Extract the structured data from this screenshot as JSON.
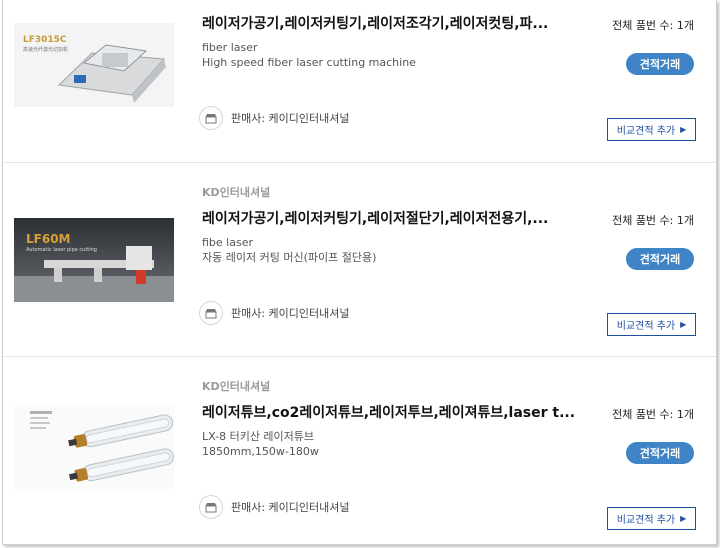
{
  "products": [
    {
      "brand": "",
      "title": "레이저가공기,레이저커팅기,레이저조각기,레이저컷팅,파...",
      "desc1": "fiber laser",
      "desc2": "High speed fiber laser cutting machine",
      "image_text": "LF3015C",
      "image_subtext": "高速光纤激光切割机",
      "seller": "판매사: 케이디인터내셔널",
      "count": "전체 품번 수: 1개",
      "quote": "견적거래",
      "compare": "비교견적 추가"
    },
    {
      "brand": "KD인터내셔널",
      "title": "레이저가공기,레이저커팅기,레이저절단기,레이저전용기,...",
      "desc1": "fibe laser",
      "desc2": "자동 레이저 커팅 머신(파이프 절단용)",
      "image_text": "LF60M",
      "image_subtext": "Automatic laser pipe cutting",
      "seller": "판매사: 케이디인터내셔널",
      "count": "전체 품번 수: 1개",
      "quote": "견적거래",
      "compare": "비교견적 추가"
    },
    {
      "brand": "KD인터내셔널",
      "title": "레이저튜브,co2레이저튜브,레이저투브,레이져튜브,laser t...",
      "desc1": "LX-8 터키산 레이저튜브",
      "desc2": "1850mm,150w-180w",
      "seller": "판매사: 케이디인터내셔널",
      "count": "전체 품번 수: 1개",
      "quote": "견적거래",
      "compare": "비교견적 추가"
    }
  ],
  "colors": {
    "quote_button": "#3e84c6",
    "compare_border": "#1e4fa0"
  }
}
